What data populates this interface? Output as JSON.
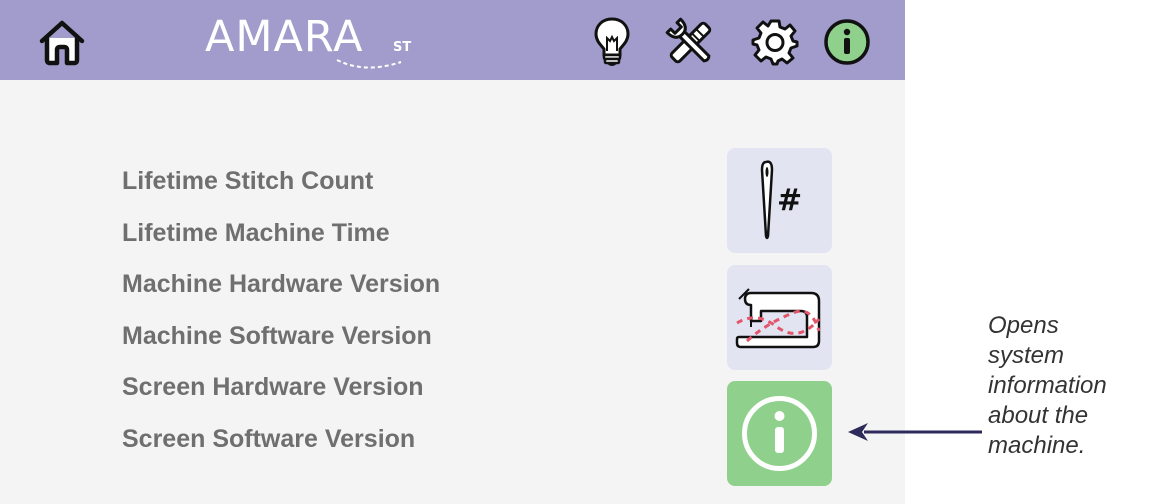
{
  "header": {
    "logo_text": "AMARA",
    "logo_sub": "ST",
    "icons": [
      "home-icon",
      "lightbulb-icon",
      "tools-icon",
      "gear-icon",
      "info-icon"
    ],
    "bar_color": "#a19ccc",
    "active_icon_color": "#8fd18c"
  },
  "info_list": {
    "items": [
      "Lifetime Stitch Count",
      "Lifetime Machine Time",
      "Machine Hardware Version",
      "Machine Software Version",
      "Screen Hardware Version",
      "Screen Software Version"
    ]
  },
  "tiles": {
    "stitch_count_symbol": "#",
    "icons": [
      "needle-stitch-count-icon",
      "sewing-machine-icon",
      "info-icon"
    ]
  },
  "callout": {
    "lines": [
      "Opens",
      "system",
      "information",
      "about the",
      "machine."
    ]
  }
}
